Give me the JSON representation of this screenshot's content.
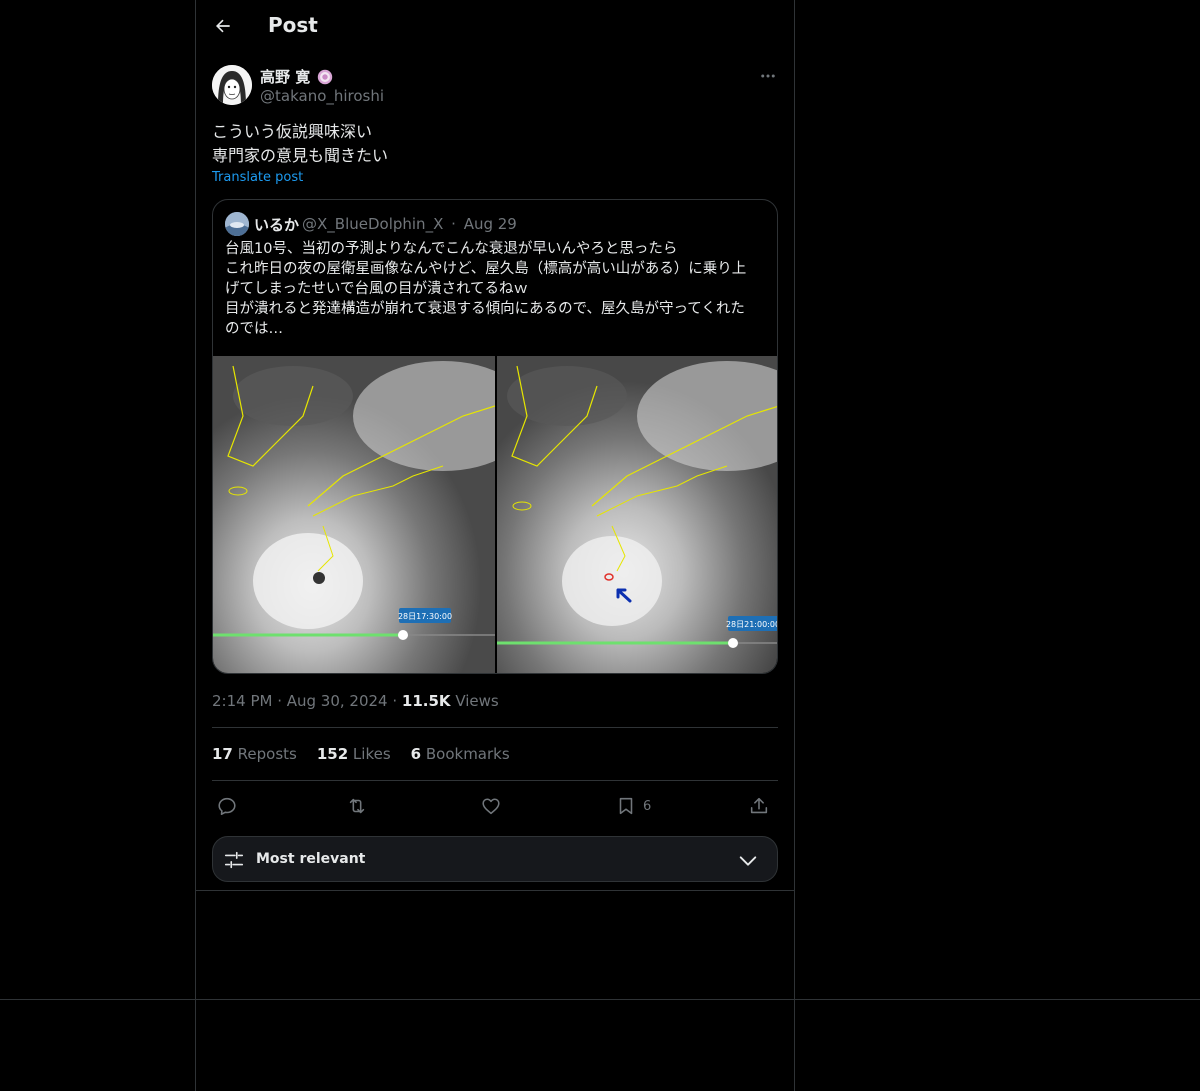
{
  "header": {
    "title": "Post"
  },
  "post": {
    "author_name": "高野 寛",
    "author_handle": "@takano_hiroshi",
    "text_lines": [
      "こういう仮説興味深い",
      "専門家の意見も聞きたい"
    ],
    "translate_label": "Translate post",
    "timestamp": "2:14 PM · Aug 30, 2024 · ",
    "views_count": "11.5K",
    "views_label": " Views"
  },
  "quote": {
    "name": "いるか",
    "handle": "@X_BlueDolphin_X",
    "dot": "·",
    "date": "Aug 29",
    "text_lines": [
      "台風10号、当初の予測よりなんでこんな衰退が早いんやろと思ったら",
      "これ昨日の夜の屋衛星画像なんやけど、屋久島（標高が高い山がある）に乗り上",
      "げてしまったせいで台風の目が潰されてるねｗ",
      "目が潰れると発達構造が崩れて衰退する傾向にあるので、屋久島が守ってくれた",
      "のでは…"
    ],
    "image_left_time": "28日17:30:00",
    "image_right_time": "28日21:00:00"
  },
  "stats": {
    "reposts_count": "17",
    "reposts_label": " Reposts",
    "likes_count": "152",
    "likes_label": " Likes",
    "bookmarks_count": "6",
    "bookmarks_label": " Bookmarks"
  },
  "actions": {
    "bookmark_count": "6"
  },
  "sort": {
    "label": "Most relevant"
  },
  "colors": {
    "background": "#000000",
    "border": "#2f3336",
    "muted": "#71767b",
    "link": "#1d9bf0",
    "text": "#e7e9ea"
  },
  "icons": [
    "arrow-left-icon",
    "verified-badge-icon",
    "more-icon",
    "reply-icon",
    "repost-icon",
    "like-icon",
    "bookmark-icon",
    "share-icon",
    "sliders-icon",
    "chevron-down-icon"
  ]
}
